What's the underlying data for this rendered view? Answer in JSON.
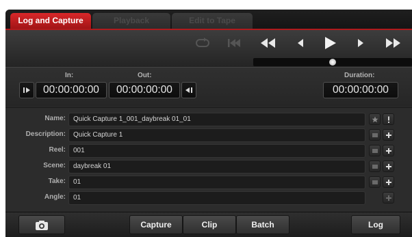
{
  "tabs": [
    {
      "label": "Log and Capture",
      "active": true
    },
    {
      "label": "Playback",
      "active": false
    },
    {
      "label": "Edit to Tape",
      "active": false
    }
  ],
  "transport": {
    "buttons": [
      "loop-icon",
      "go-to-start-icon",
      "rewind-icon",
      "step-back-icon",
      "play-icon",
      "step-forward-icon",
      "fast-forward-icon"
    ],
    "scrub_position": 0.5
  },
  "timecode": {
    "in_label": "In:",
    "out_label": "Out:",
    "duration_label": "Duration:",
    "in_value": "00:00:00:00",
    "out_value": "00:00:00:00",
    "duration_value": "00:00:00:00"
  },
  "fields": [
    {
      "label": "Name:",
      "value": "Quick Capture 1_001_daybreak 01_01"
    },
    {
      "label": "Description:",
      "value": "Quick Capture 1"
    },
    {
      "label": "Reel:",
      "value": "001"
    },
    {
      "label": "Scene:",
      "value": "daybreak 01"
    },
    {
      "label": "Take:",
      "value": "01"
    },
    {
      "label": "Angle:",
      "value": "01"
    }
  ],
  "bottom": {
    "capture_label": "Capture",
    "clip_label": "Clip",
    "batch_label": "Batch",
    "log_label": "Log"
  },
  "colors": {
    "accent": "#c21f21",
    "background": "#2a2a2a"
  }
}
